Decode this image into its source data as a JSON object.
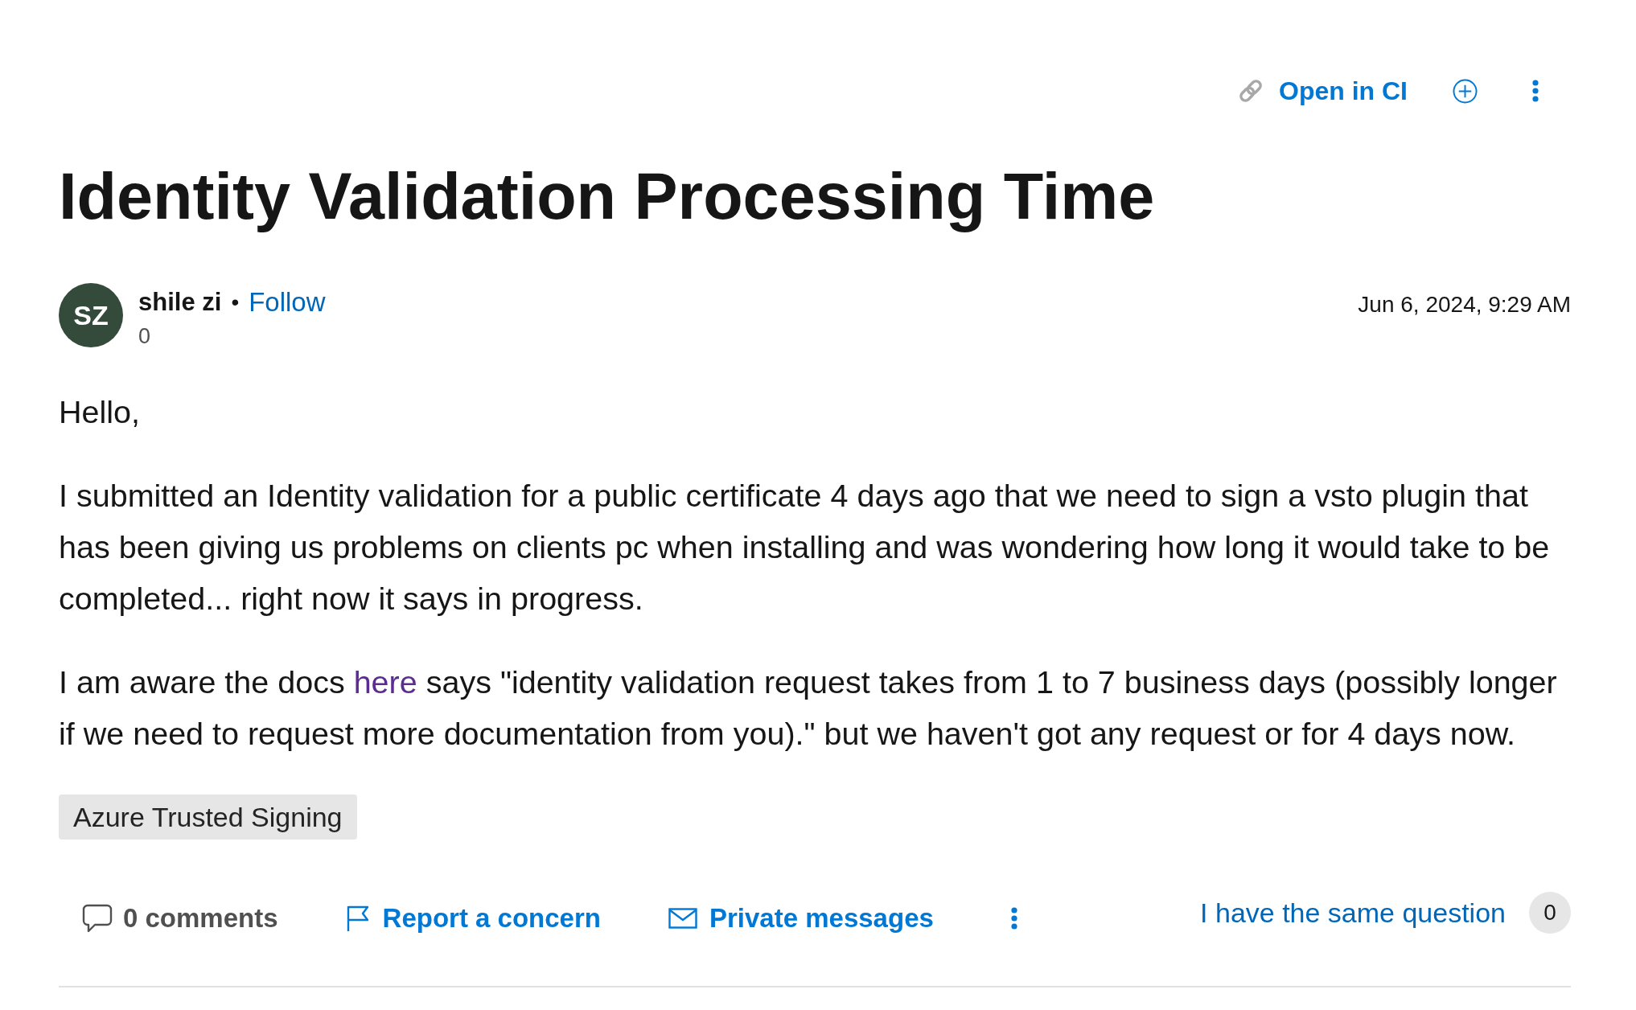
{
  "toolbar": {
    "open_link": "Open in CI"
  },
  "title": "Identity Validation Processing Time",
  "author": {
    "initials": "SZ",
    "name": "shile zi",
    "separator": "•",
    "follow": "Follow",
    "reputation": "0"
  },
  "date": "Jun 6, 2024, 9:29 AM",
  "body": [
    [
      {
        "kind": "text",
        "text": "Hello,"
      }
    ],
    [
      {
        "kind": "text",
        "text": "I submitted an Identity validation for a public certificate 4 days ago that we need to sign a vsto plugin that has been giving us problems on clients pc when installing and was wondering how long it would take to be completed... right now it says in progress."
      }
    ],
    [
      {
        "kind": "text",
        "text": "I am aware the docs "
      },
      {
        "kind": "link",
        "text": "here"
      },
      {
        "kind": "text",
        "text": " says \"identity validation request takes from 1 to 7 business days (possibly longer if we need to request more documentation from you).\" but we haven't got any request or for 4 days now."
      }
    ]
  ],
  "tags": [
    "Azure Trusted Signing"
  ],
  "actions": [
    {
      "kind": "comments",
      "label": "0 comments"
    },
    {
      "kind": "report",
      "label": "Report a concern"
    },
    {
      "kind": "messages",
      "label": "Private messages"
    }
  ],
  "same_question": {
    "label": "I have the same question",
    "count": "0"
  }
}
